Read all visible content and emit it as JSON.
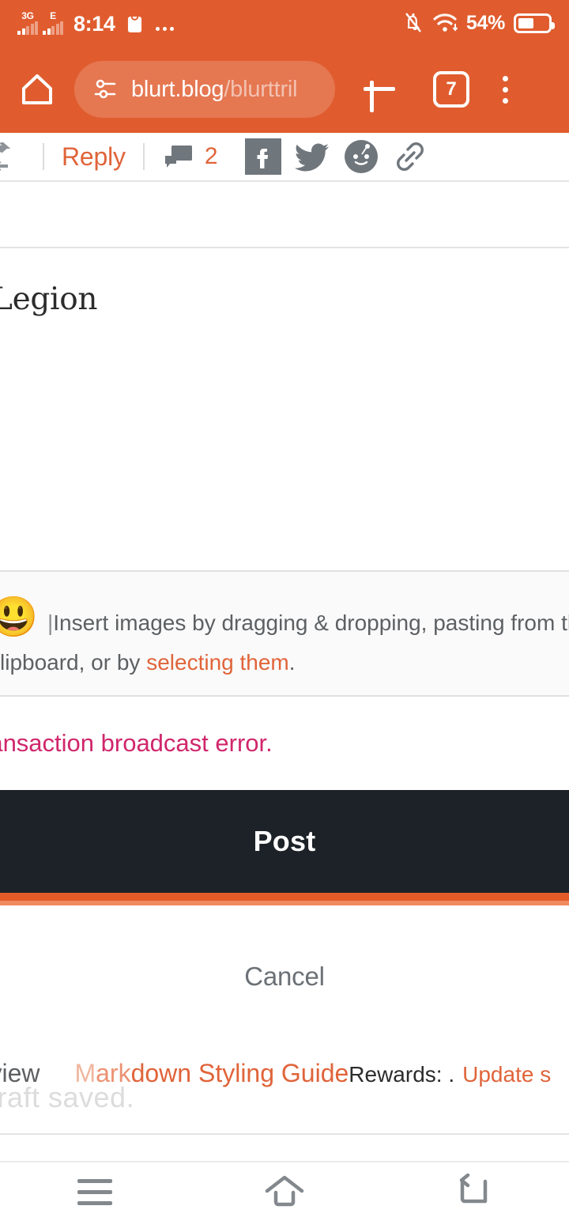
{
  "status_bar": {
    "sim1_network": "3G",
    "sim2_network": "E",
    "time": "8:14",
    "battery_percent": "54%",
    "battery_level": 54,
    "icons": [
      "signal-bars-3g",
      "signal-bars-edge",
      "shopping-bag-icon",
      "overflow-dots-icon",
      "bell-muted-icon",
      "wifi-icon",
      "battery-icon"
    ],
    "accent_color": "#e05c2e"
  },
  "browser": {
    "url_host": "blurt.blog",
    "url_path": "/blurttril",
    "tab_count": "7",
    "home_label": "Home",
    "new_tab_label": "New tab",
    "menu_label": "More options"
  },
  "post_actions": {
    "resteem_label": "Resteem",
    "reply_label": "Reply",
    "comment_count": "2",
    "social": [
      "facebook-icon",
      "twitter-icon",
      "reddit-icon",
      "link-icon"
    ]
  },
  "editor": {
    "title_value": "Legion",
    "emoji": "😃",
    "insert_caret": "|",
    "insert_help_line1": "Insert images by dragging & dropping, pasting from the",
    "insert_help_line2_pre": "clipboard, or by ",
    "insert_help_link": "selecting them",
    "insert_help_line2_post": ".",
    "error_message": "ransaction broadcast error.",
    "error_color": "#d0266b"
  },
  "buttons": {
    "post_label": "Post",
    "cancel_label": "Cancel"
  },
  "footer": {
    "preview_label": "review",
    "markdown_guide_label": "Markdown Styling Guide",
    "markdown_fade1": "M",
    "markdown_fade2": "ark",
    "markdown_rest": "down Styling Guide",
    "rewards_label": "Rewards: .",
    "update_settings_label": "Update s",
    "draft_saved_label": "Draft saved."
  },
  "nav_bar": {
    "recents_label": "Recents",
    "home_label": "Home",
    "back_label": "Back"
  }
}
